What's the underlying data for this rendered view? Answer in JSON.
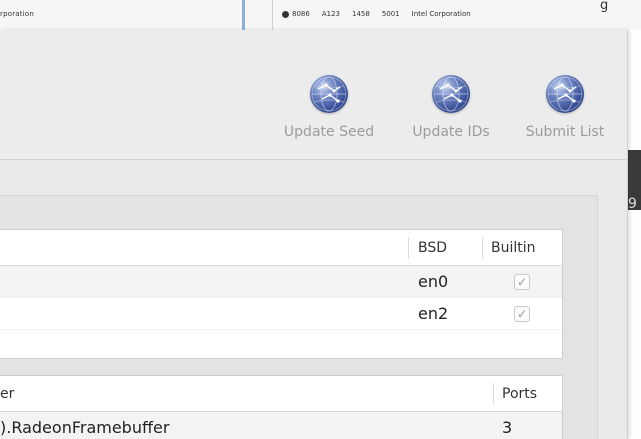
{
  "background_window": {
    "left_text": "rporation",
    "row": {
      "vendor": "8086",
      "device": "A123",
      "subsys_vendor": "1458",
      "subsys_device": "5001",
      "vendor_name": "Intel Corporation"
    },
    "top_right_glyph": "g"
  },
  "toolbar": {
    "buttons": [
      {
        "label": "Update Seed",
        "icon": "globe-icon"
      },
      {
        "label": "Update IDs",
        "icon": "globe-icon"
      },
      {
        "label": "Submit List",
        "icon": "globe-icon"
      }
    ]
  },
  "side_char": "9",
  "network_table": {
    "columns": [
      "BSD",
      "Builtin"
    ],
    "rows": [
      {
        "bsd": "en0",
        "builtin": true
      },
      {
        "bsd": "en2",
        "builtin": true
      }
    ]
  },
  "graphics_table": {
    "columns": [
      "er",
      "Ports"
    ],
    "rows": [
      {
        "name": ").RadeonFramebuffer",
        "ports": "3"
      }
    ]
  },
  "colors": {
    "window_bg": "#ececec",
    "label_disabled": "#9c9c9c",
    "globe_blue": "#324a92",
    "row_alt": "#f3f3f3"
  }
}
